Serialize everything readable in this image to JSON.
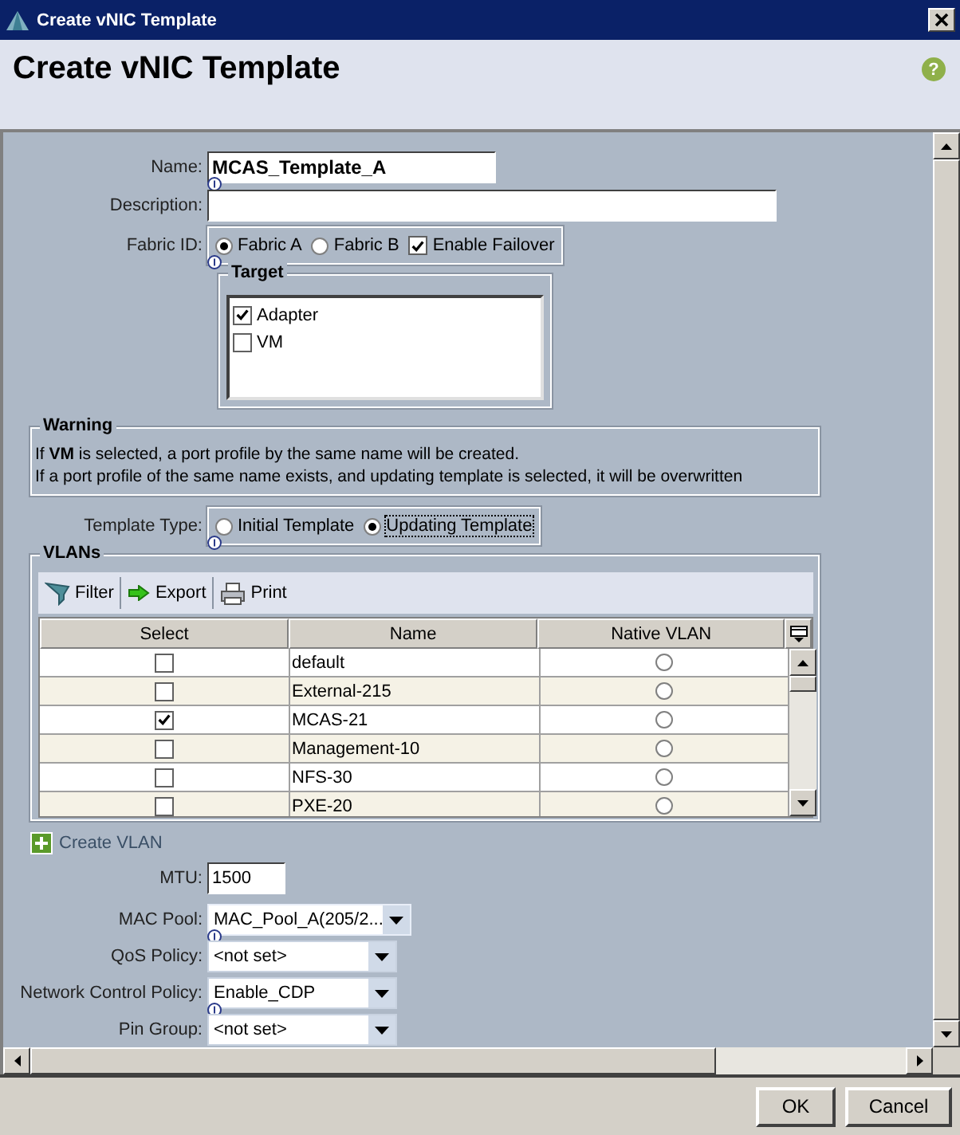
{
  "window": {
    "title": "Create vNIC Template"
  },
  "header": {
    "title": "Create vNIC Template",
    "help": "?"
  },
  "form": {
    "name": {
      "label": "Name:",
      "value": "MCAS_Template_A",
      "info": true
    },
    "description": {
      "label": "Description:",
      "info": false
    },
    "fabric_id": {
      "label": "Fabric ID:",
      "info": true,
      "options": [
        {
          "label": "Fabric A",
          "selected": true
        },
        {
          "label": "Fabric B",
          "selected": false
        }
      ],
      "failover": {
        "label": "Enable Failover",
        "checked": true
      }
    },
    "target": {
      "title": "Target",
      "items": [
        {
          "label": "Adapter",
          "checked": true
        },
        {
          "label": "VM",
          "checked": false
        }
      ]
    },
    "warning": {
      "title": "Warning",
      "lines": [
        "If **VM** is selected, a port profile by the same name will be created.",
        "If a port profile of the same name exists, and updating template is selected, it will be overwritten"
      ]
    },
    "template_type": {
      "label": "Template Type:",
      "info": true,
      "options": [
        {
          "label": "Initial Template",
          "selected": false
        },
        {
          "label": "Updating Template",
          "selected": true
        }
      ]
    },
    "vlans": {
      "title": "VLANs",
      "toolbar": [
        {
          "label": "Filter",
          "kind": "filter"
        },
        {
          "label": "Export",
          "kind": "export"
        },
        {
          "label": "Print",
          "kind": "print"
        }
      ],
      "columns": [
        "Select",
        "Name",
        "Native VLAN"
      ],
      "rows": [
        {
          "checked": false,
          "name": "default",
          "native": false
        },
        {
          "checked": false,
          "name": "External-215",
          "native": false
        },
        {
          "checked": true,
          "name": "MCAS-21",
          "native": false
        },
        {
          "checked": false,
          "name": "Management-10",
          "native": false
        },
        {
          "checked": false,
          "name": "NFS-30",
          "native": false
        },
        {
          "checked": false,
          "name": "PXE-20",
          "native": false
        }
      ]
    },
    "create_vlan": "Create VLAN",
    "mtu": {
      "label": "MTU:",
      "value": "1500"
    },
    "dropdowns": [
      {
        "label": "MAC Pool:",
        "value": "MAC_Pool_A(205/2...",
        "info": true
      },
      {
        "label": "QoS Policy:",
        "value": "<not set>",
        "info": false
      },
      {
        "label": "Network Control Policy:",
        "value": "Enable_CDP",
        "info": true
      },
      {
        "label": "Pin Group:",
        "value": "<not set>",
        "info": false
      }
    ]
  },
  "buttons": [
    "OK",
    "Cancel"
  ]
}
